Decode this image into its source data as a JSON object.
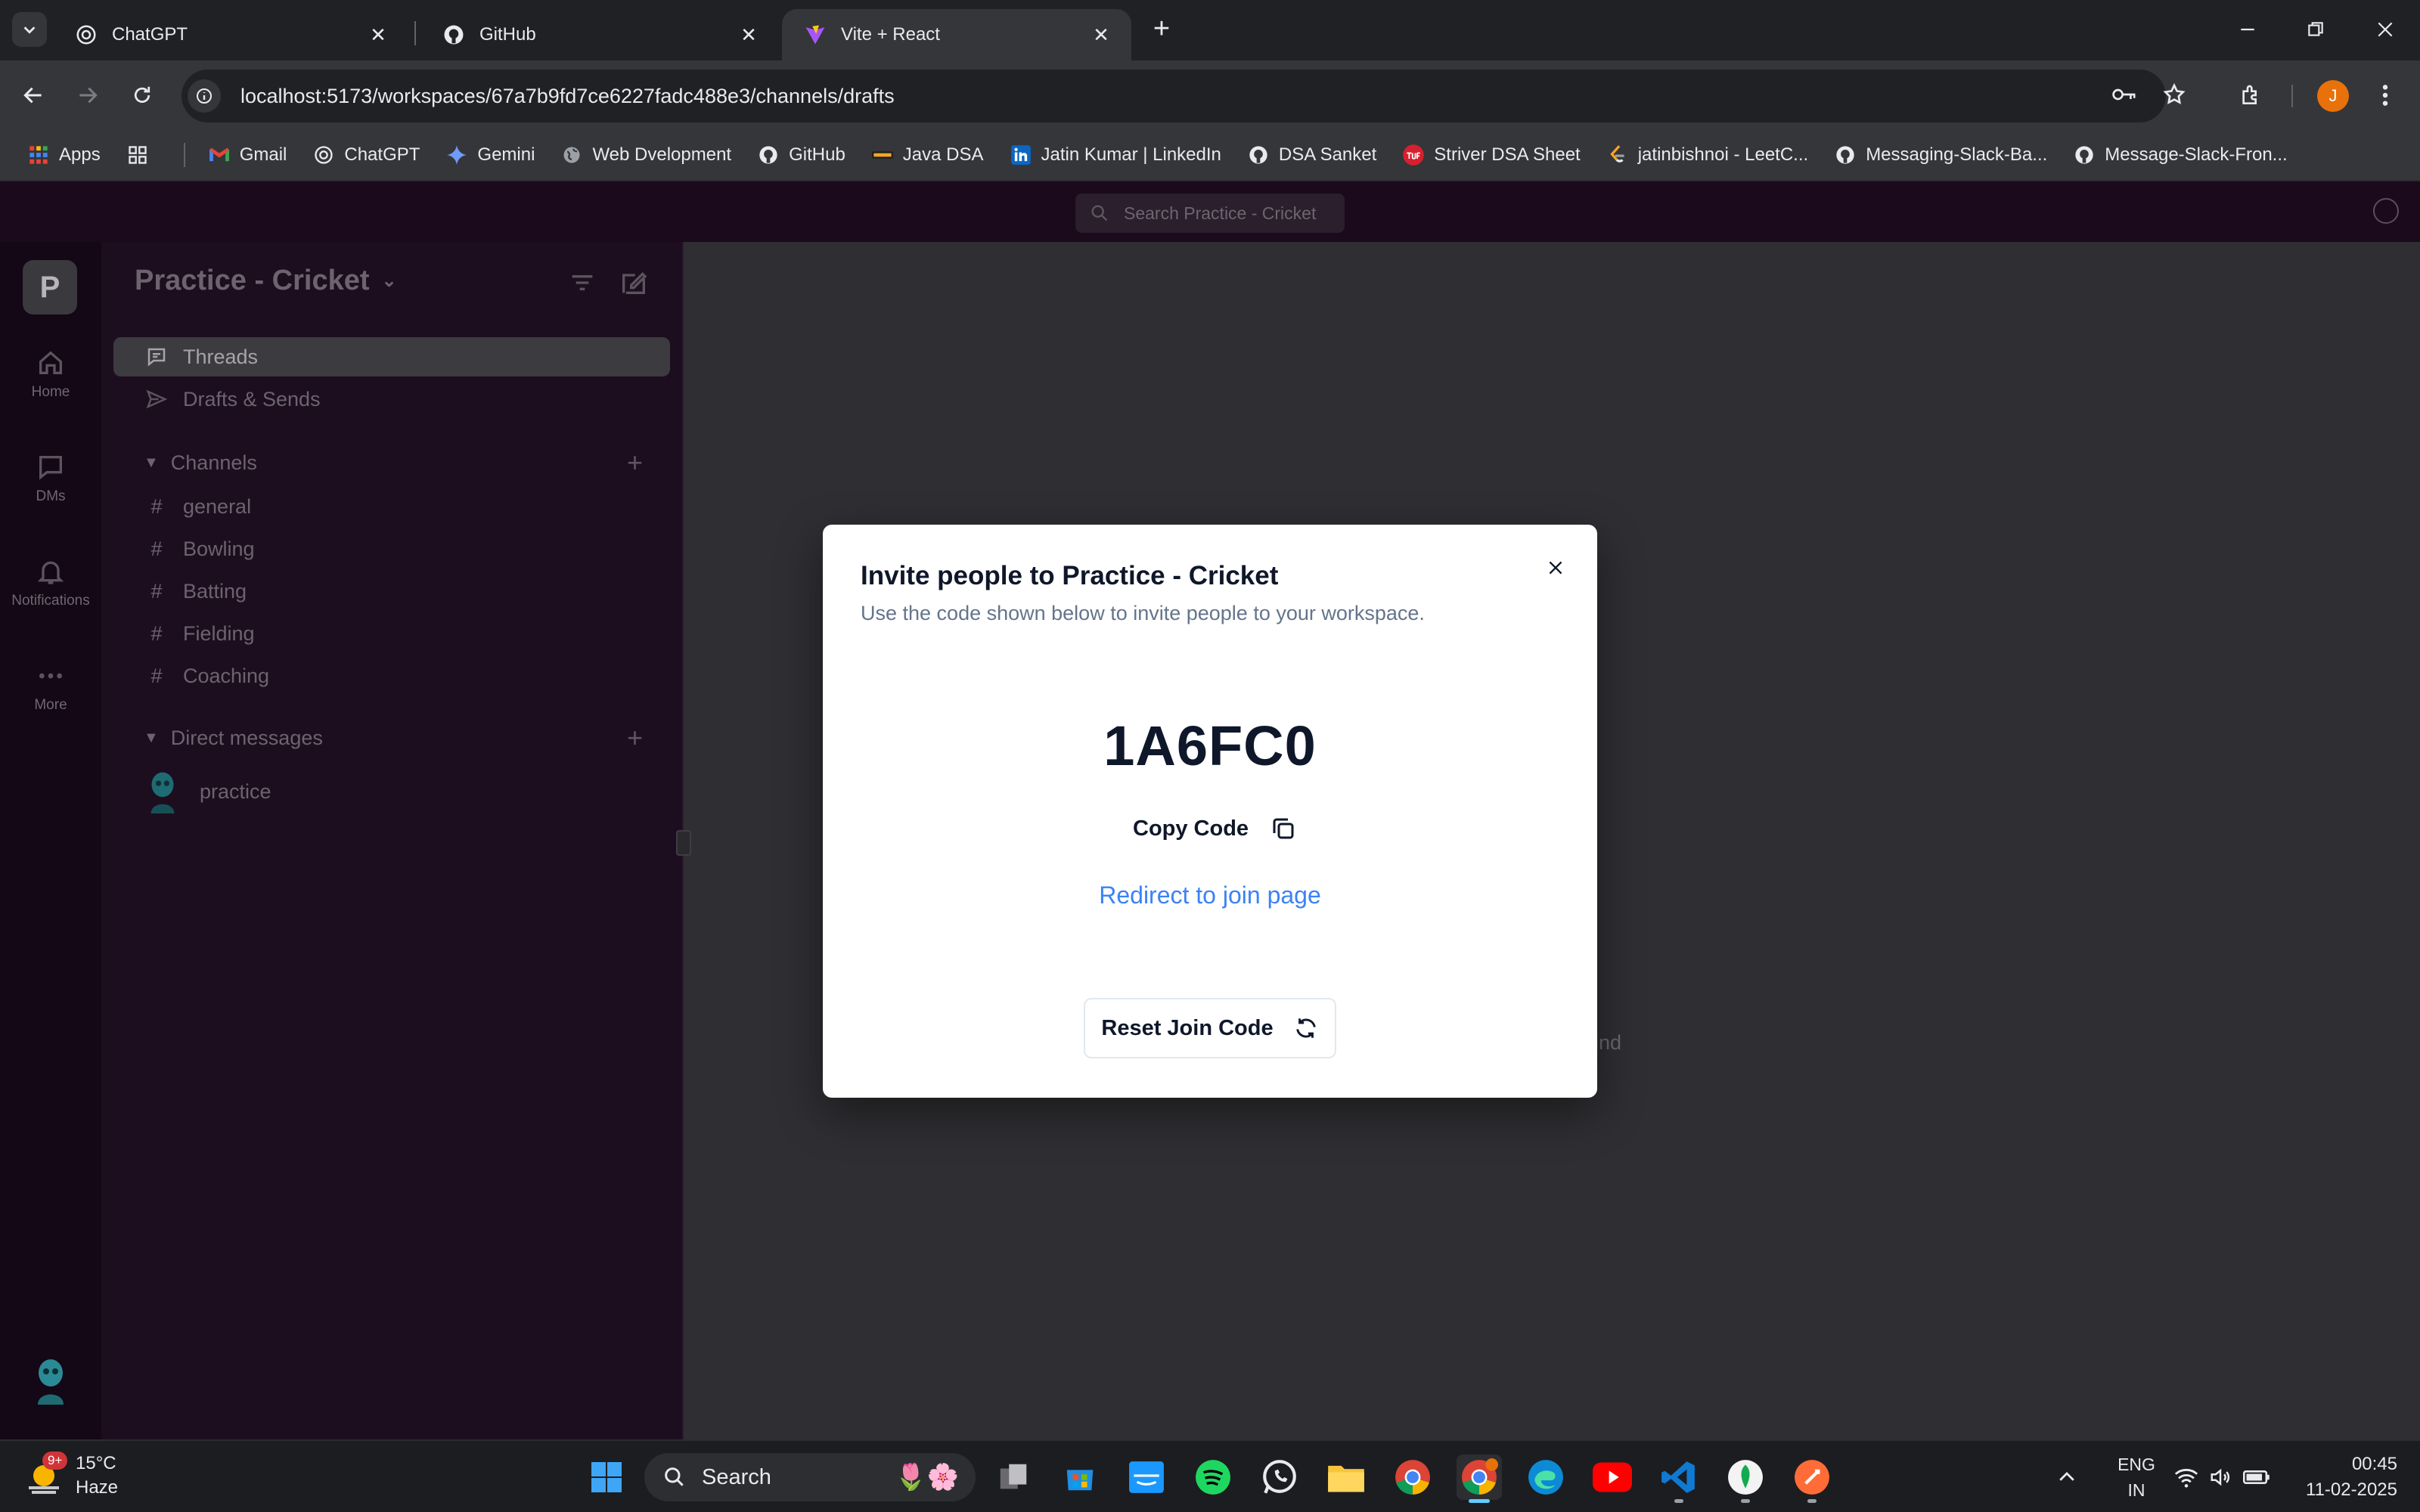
{
  "browser": {
    "tabs": [
      {
        "title": "ChatGPT",
        "active": false
      },
      {
        "title": "GitHub",
        "active": false
      },
      {
        "title": "Vite + React",
        "active": true
      }
    ],
    "url": "localhost:5173/workspaces/67a7b9fd7ce6227fadc488e3/channels/drafts",
    "profile_initial": "J",
    "bookmarks": [
      {
        "label": "Apps",
        "icon": "apps-grid-icon"
      },
      {
        "label": "",
        "icon": "grid-icon"
      },
      {
        "label": "Gmail",
        "icon": "gmail-icon"
      },
      {
        "label": "ChatGPT",
        "icon": "chatgpt-icon"
      },
      {
        "label": "Gemini",
        "icon": "gemini-icon"
      },
      {
        "label": "Web Dvelopment",
        "icon": "globe-icon"
      },
      {
        "label": "GitHub",
        "icon": "github-icon"
      },
      {
        "label": "Java DSA",
        "icon": "coding-icon"
      },
      {
        "label": "Jatin Kumar | LinkedIn",
        "icon": "linkedin-icon"
      },
      {
        "label": "DSA Sanket",
        "icon": "github-icon"
      },
      {
        "label": "Striver DSA Sheet",
        "icon": "tuf-icon"
      },
      {
        "label": "jatinbishnoi - LeetC...",
        "icon": "leetcode-icon"
      },
      {
        "label": "Messaging-Slack-Ba...",
        "icon": "github-icon"
      },
      {
        "label": "Message-Slack-Fron...",
        "icon": "github-icon"
      }
    ]
  },
  "app": {
    "search_placeholder": "Search Practice - Cricket",
    "workspace_initial": "P",
    "rail": [
      {
        "label": "Home",
        "icon": "home-icon"
      },
      {
        "label": "DMs",
        "icon": "chat-icon"
      },
      {
        "label": "Notifications",
        "icon": "bell-icon"
      },
      {
        "label": "More",
        "icon": "more-icon"
      }
    ],
    "workspace_name": "Practice - Cricket",
    "nav": [
      {
        "label": "Threads",
        "icon": "threads-icon",
        "active": true
      },
      {
        "label": "Drafts & Sends",
        "icon": "send-icon",
        "active": false
      }
    ],
    "channels_header": "Channels",
    "channels": [
      "general",
      "Bowling",
      "Batting",
      "Fielding",
      "Coaching"
    ],
    "dm_header": "Direct messages",
    "dms": [
      "practice"
    ],
    "background_text": "ound"
  },
  "modal": {
    "title": "Invite people to Practice - Cricket",
    "description": "Use the code shown below to invite people to your workspace.",
    "join_code": "1A6FC0",
    "copy_label": "Copy Code",
    "redirect_label": "Redirect to join page",
    "reset_label": "Reset Join Code"
  },
  "taskbar": {
    "weather_temp": "15°C",
    "weather_desc": "Haze",
    "weather_badge": "9+",
    "search_label": "Search",
    "lang_line1": "ENG",
    "lang_line2": "IN",
    "time": "00:45",
    "date": "11-02-2025"
  },
  "colors": {
    "accent_link": "#3b82f6",
    "profile": "#e8710a",
    "app_sidebar": "#1d0e1f"
  }
}
